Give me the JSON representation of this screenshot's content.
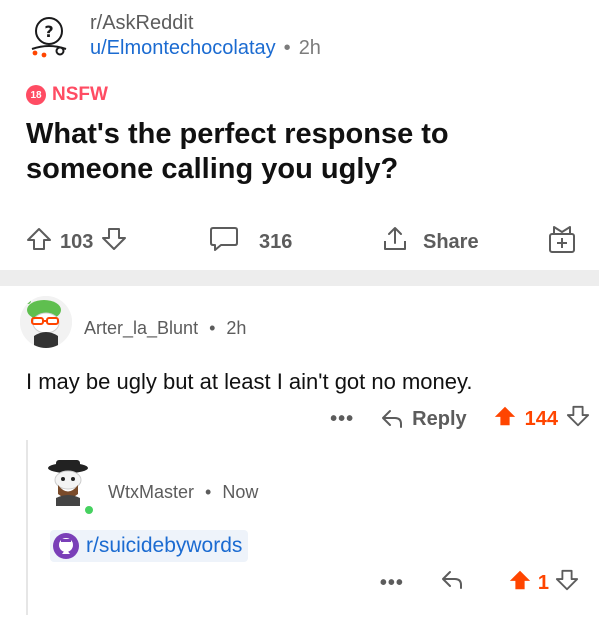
{
  "post": {
    "subreddit": "r/AskReddit",
    "author": "u/Elmontechocolatay",
    "separator": "•",
    "age": "2h",
    "nsfw_badge": "18",
    "nsfw_label": "NSFW",
    "title": "What's the perfect response to someone calling you ugly?",
    "votes": "103",
    "comments": "316",
    "share_label": "Share"
  },
  "comment": {
    "author": "Arter_la_Blunt",
    "separator": "•",
    "age": "2h",
    "body": "I may be ugly but at least I ain't got no money.",
    "more": "•••",
    "reply_label": "Reply",
    "score": "144"
  },
  "reply": {
    "author": "WtxMaster",
    "separator": "•",
    "age": "Now",
    "link": "r/suicidebywords",
    "more": "•••",
    "score": "1"
  },
  "colors": {
    "upvote": "#ff4500",
    "link": "#1b6bd1",
    "nsfw": "#ff4c63",
    "online": "#46d160"
  }
}
